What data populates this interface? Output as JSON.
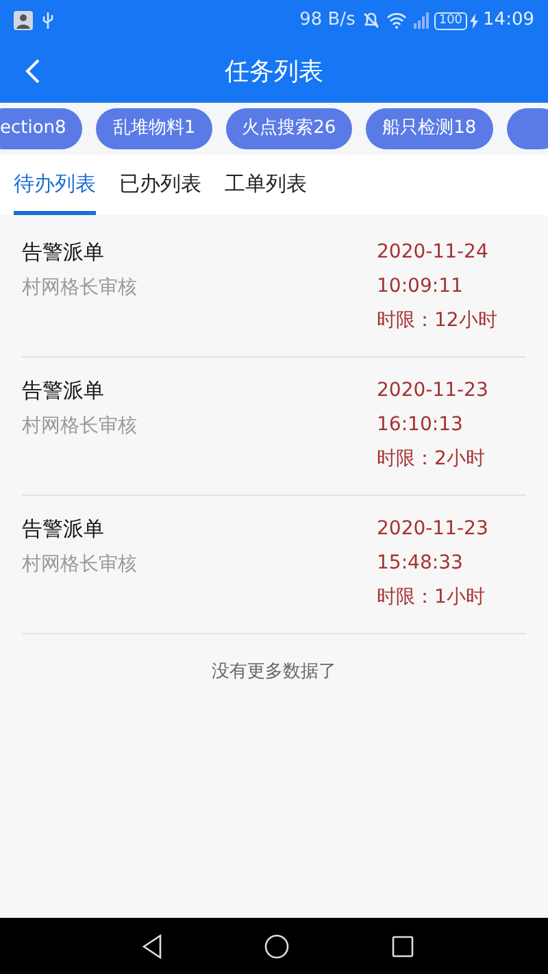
{
  "status_bar": {
    "speed": "98 B/s",
    "battery": "100",
    "time": "14:09"
  },
  "header": {
    "title": "任务列表"
  },
  "chips": [
    {
      "label": "ection8"
    },
    {
      "label": "乱堆物料1"
    },
    {
      "label": "火点搜索26"
    },
    {
      "label": "船只检测18"
    }
  ],
  "tabs": [
    {
      "label": "待办列表",
      "selected": true
    },
    {
      "label": "已办列表",
      "selected": false
    },
    {
      "label": "工单列表",
      "selected": false
    }
  ],
  "tasks": [
    {
      "title": "告警派单",
      "subtitle": "村网格长审核",
      "date": "2020-11-24",
      "time": "10:09:11",
      "limit": "时限：12小时"
    },
    {
      "title": "告警派单",
      "subtitle": "村网格长审核",
      "date": "2020-11-23",
      "time": "16:10:13",
      "limit": "时限：2小时"
    },
    {
      "title": "告警派单",
      "subtitle": "村网格长审核",
      "date": "2020-11-23",
      "time": "15:48:33",
      "limit": "时限：1小时"
    }
  ],
  "footer": "没有更多数据了"
}
